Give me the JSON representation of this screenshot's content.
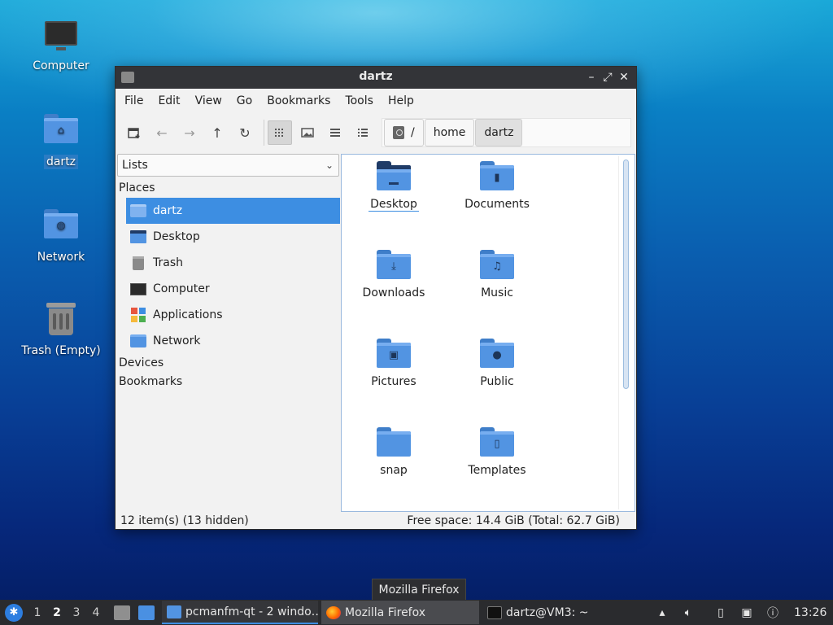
{
  "desktop": {
    "icons": [
      {
        "label": "Computer"
      },
      {
        "label": "dartz"
      },
      {
        "label": "Network"
      },
      {
        "label": "Trash (Empty)"
      }
    ]
  },
  "window": {
    "title": "dartz",
    "controls": {
      "minimize": "–",
      "maximize": "⤢",
      "close": "✕"
    },
    "menu": [
      "File",
      "Edit",
      "View",
      "Go",
      "Bookmarks",
      "Tools",
      "Help"
    ],
    "path": [
      {
        "label": "/"
      },
      {
        "label": "home"
      },
      {
        "label": "dartz"
      }
    ],
    "sidebar": {
      "view_selector": "Lists",
      "places_heading": "Places",
      "places": [
        {
          "label": "dartz",
          "icon": "home-folder-icon"
        },
        {
          "label": "Desktop",
          "icon": "desktop-icon"
        },
        {
          "label": "Trash",
          "icon": "trash-icon"
        },
        {
          "label": "Computer",
          "icon": "computer-icon"
        },
        {
          "label": "Applications",
          "icon": "applications-icon"
        },
        {
          "label": "Network",
          "icon": "network-icon"
        }
      ],
      "devices_heading": "Devices",
      "bookmarks_heading": "Bookmarks"
    },
    "files": [
      {
        "label": "Desktop",
        "emblem": "desktop"
      },
      {
        "label": "Documents",
        "emblem": "document"
      },
      {
        "label": "Downloads",
        "emblem": "download"
      },
      {
        "label": "Music",
        "emblem": "music"
      },
      {
        "label": "Pictures",
        "emblem": "picture"
      },
      {
        "label": "Public",
        "emblem": "person"
      },
      {
        "label": "snap",
        "emblem": "none"
      },
      {
        "label": "Templates",
        "emblem": "template"
      }
    ],
    "status": {
      "items": "12 item(s) (13 hidden)",
      "space": "Free space: 14.4 GiB (Total: 62.7 GiB)"
    }
  },
  "tooltip": "Mozilla Firefox",
  "taskbar": {
    "workspaces": [
      "1",
      "2",
      "3",
      "4"
    ],
    "current_workspace": "2",
    "tasks": [
      {
        "label": "pcmanfm-qt - 2 windo…"
      },
      {
        "label": "Mozilla Firefox"
      },
      {
        "label": "dartz@VM3: ~"
      }
    ],
    "clock": "13:26"
  },
  "colors": {
    "accent": "#3d8ee2",
    "folder": "#5294e2",
    "titlebar": "#333438",
    "taskbar": "#2a2b2e"
  }
}
